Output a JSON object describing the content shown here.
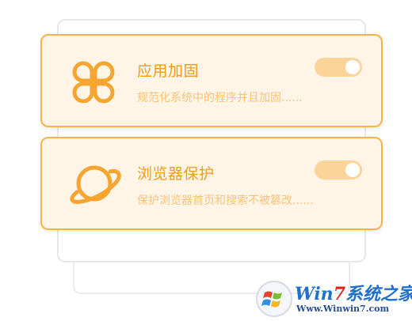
{
  "cards": [
    {
      "title": "应用加固",
      "description": "规范化系统中的程序并且加固......",
      "icon": "clover-icon",
      "toggle_on": true
    },
    {
      "title": "浏览器保护",
      "description": "保护浏览器首页和搜索不被篡改......",
      "icon": "planet-icon",
      "toggle_on": true
    }
  ],
  "watermark": {
    "brand_prefix": "Win",
    "brand_number": "7",
    "brand_suffix": "系统之家",
    "url": "Www.Winwin7.com"
  },
  "colors": {
    "accent": "#f39a1b",
    "card_bg": "#fff5e6",
    "card_border": "#f7b24a",
    "desc_text": "#f8c27a",
    "toggle_bg": "#fcd49a"
  }
}
